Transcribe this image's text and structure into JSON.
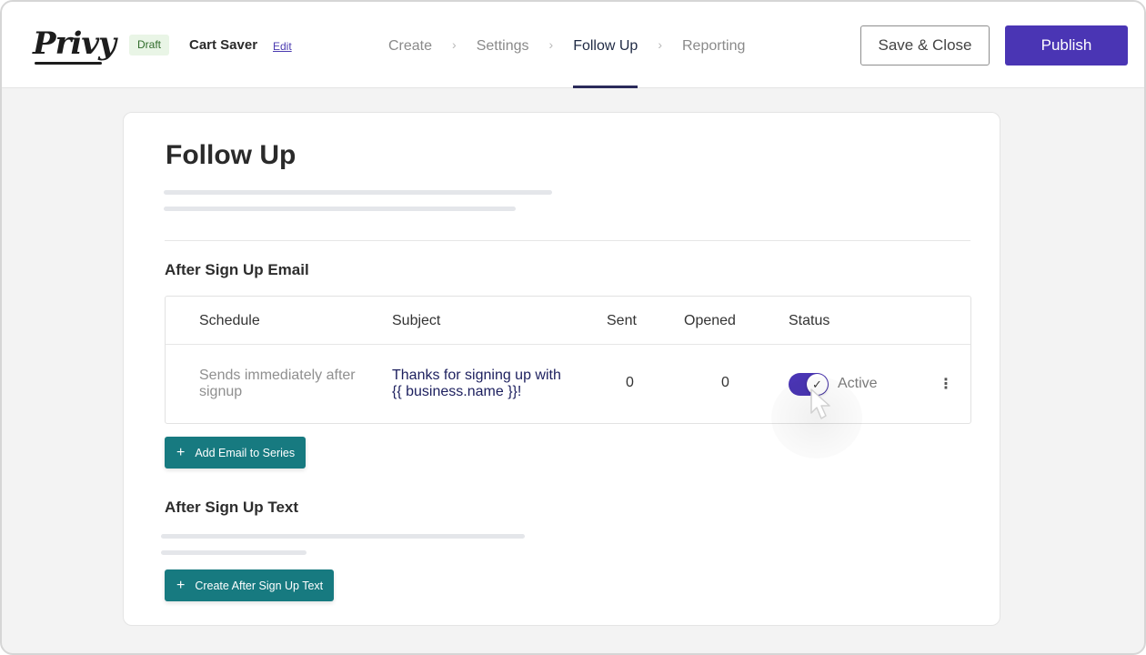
{
  "header": {
    "logo_text": "Privy",
    "draft_badge": "Draft",
    "campaign_name": "Cart Saver",
    "edit_label": "Edit",
    "nav": [
      {
        "label": "Create",
        "active": false
      },
      {
        "label": "Settings",
        "active": false
      },
      {
        "label": "Follow Up",
        "active": true
      },
      {
        "label": "Reporting",
        "active": false
      }
    ],
    "nav_separator": "›",
    "save_close_label": "Save & Close",
    "publish_label": "Publish"
  },
  "main": {
    "title": "Follow Up",
    "email_section": {
      "title": "After Sign Up Email",
      "columns": [
        "Schedule",
        "Subject",
        "Sent",
        "Opened",
        "Status"
      ],
      "rows": [
        {
          "schedule": "Sends immediately after signup",
          "subject": "Thanks for signing up with {{ business.name }}!",
          "sent": "0",
          "opened": "0",
          "status": "Active",
          "status_on": true
        }
      ],
      "add_button_label": "Add Email to Series"
    },
    "text_section": {
      "title": "After Sign Up Text",
      "create_button_label": "Create After Sign Up Text"
    }
  },
  "icons": {
    "plus": "plus-icon",
    "check": "check-icon",
    "kebab": "kebab-menu-icon",
    "chevron": "chevron-right-icon",
    "cursor": "hand-pointer-icon"
  },
  "colors": {
    "brand_purple": "#4a35b4",
    "teal": "#177a80",
    "draft_badge_bg": "#e9f5e6"
  }
}
